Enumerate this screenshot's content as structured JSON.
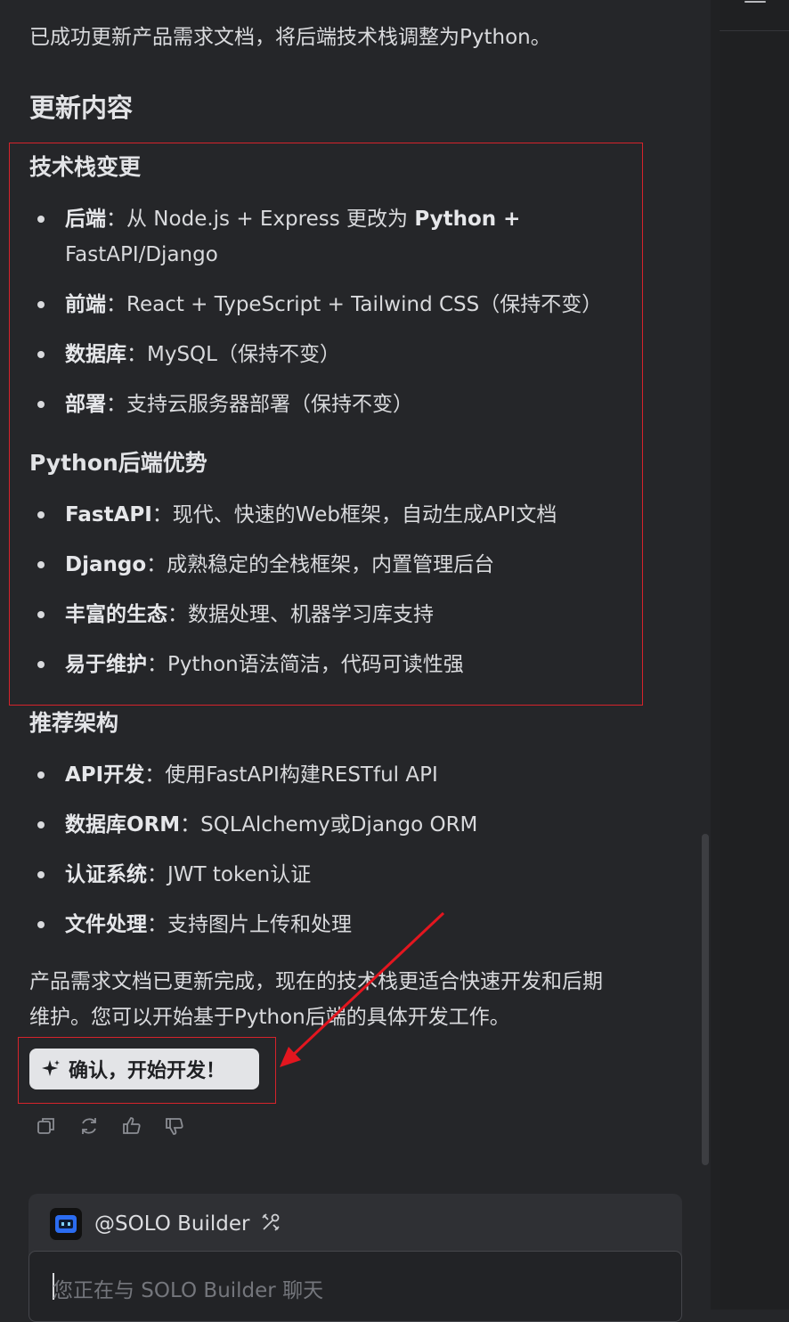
{
  "intro": "已成功更新产品需求文档，将后端技术栈调整为Python。",
  "section_title": "更新内容",
  "tech_change": {
    "title": "技术栈变更",
    "items": [
      {
        "label": "后端",
        "text": "：从 Node.js + Express 更改为 ",
        "bold": "Python +",
        "line2": "FastAPI/Django"
      },
      {
        "label": "前端",
        "text": "：React + TypeScript + Tailwind CSS（保持不变）"
      },
      {
        "label": "数据库",
        "text": "：MySQL（保持不变）"
      },
      {
        "label": "部署",
        "text": "：支持云服务器部署（保持不变）"
      }
    ]
  },
  "python_adv": {
    "title": "Python后端优势",
    "items": [
      {
        "label": "FastAPI",
        "text": "：现代、快速的Web框架，自动生成API文档"
      },
      {
        "label": "Django",
        "text": "：成熟稳定的全栈框架，内置管理后台"
      },
      {
        "label": "丰富的生态",
        "text": "：数据处理、机器学习库支持"
      },
      {
        "label": "易于维护",
        "text": "：Python语法简洁，代码可读性强"
      }
    ]
  },
  "arch": {
    "title": "推荐架构",
    "items": [
      {
        "label": "API开发",
        "text": "：使用FastAPI构建RESTful API"
      },
      {
        "label": "数据库ORM",
        "text": "：SQLAlchemy或Django ORM"
      },
      {
        "label": "认证系统",
        "text": "：JWT token认证"
      },
      {
        "label": "文件处理",
        "text": "：支持图片上传和处理"
      }
    ]
  },
  "closing": {
    "line1": "产品需求文档已更新完成，现在的技术栈更适合快速开发和后期",
    "line2": "维护。您可以开始基于Python后端的具体开发工作。"
  },
  "confirm_label": "确认，开始开发！",
  "composer": {
    "agent_name": "@SOLO Builder",
    "placeholder": "您正在与 SOLO Builder 聊天"
  },
  "icons": {
    "copy": "copy-icon",
    "regenerate": "refresh-icon",
    "like": "thumbs-up-icon",
    "dislike": "thumbs-down-icon",
    "sparkle": "sparkle-icon",
    "tool": "tools-icon",
    "menu": "menu-icon"
  },
  "colors": {
    "annotation_red": "#d6232b",
    "background": "#252629",
    "button_bg": "#e3e4e7"
  }
}
